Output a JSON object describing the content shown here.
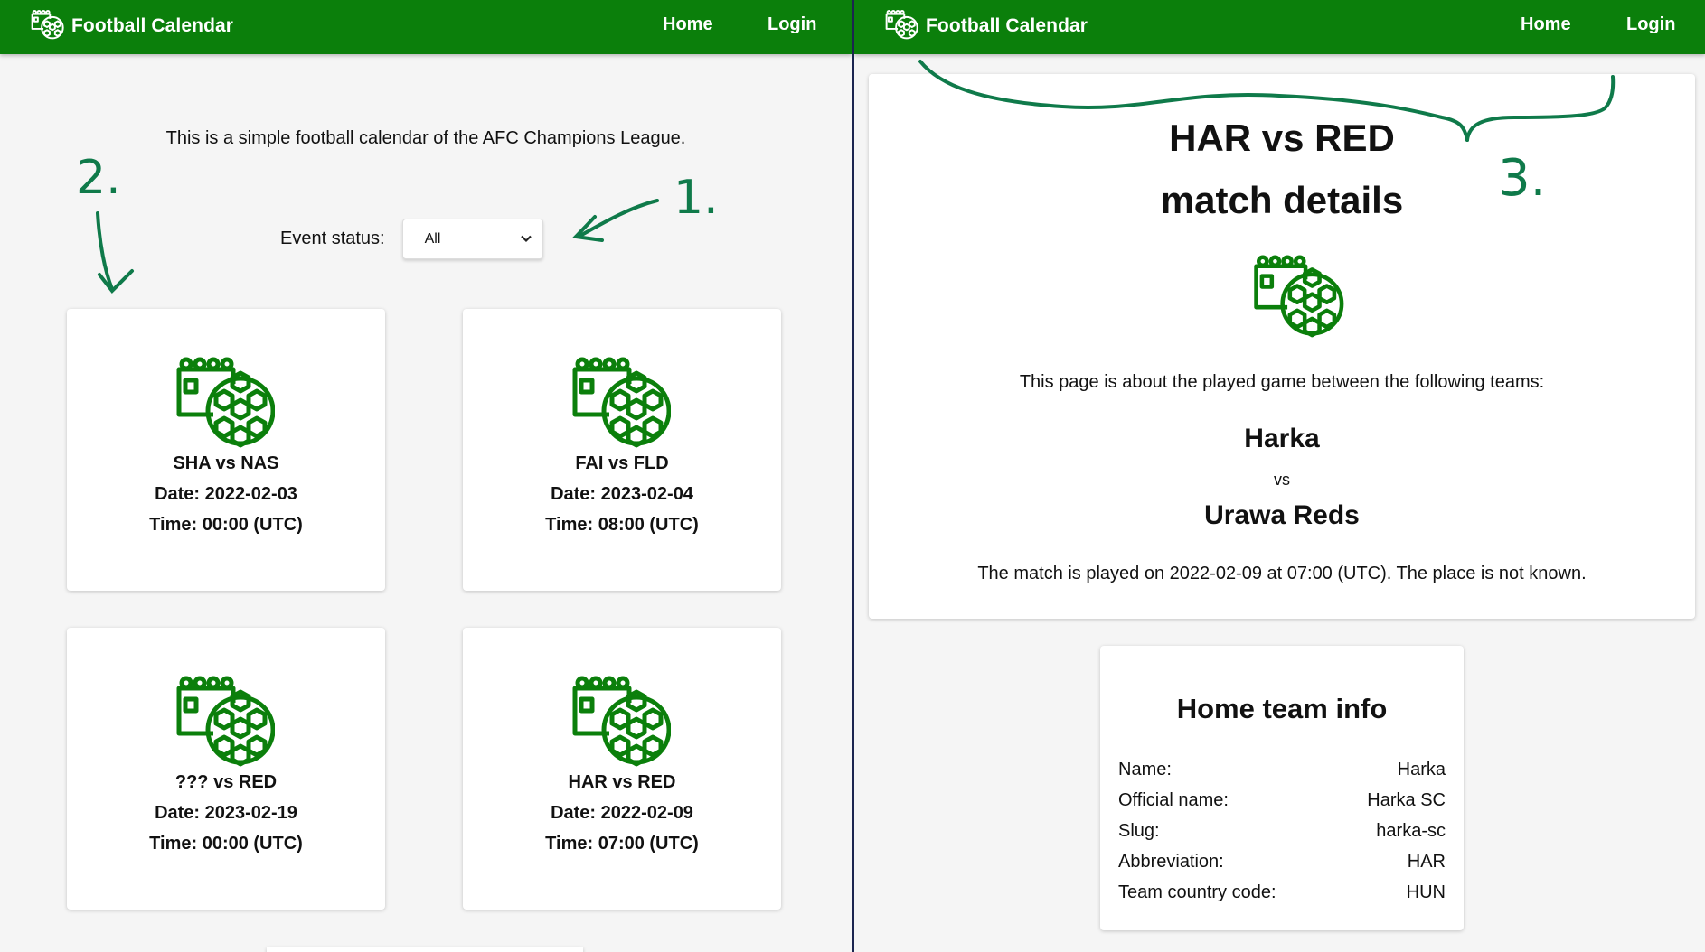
{
  "app": {
    "brand": "Football Calendar",
    "nav": {
      "home": "Home",
      "login": "Login"
    },
    "colors": {
      "accent": "#0b7f0b",
      "annotation": "#0f7a4a",
      "divider": "#1b2550"
    }
  },
  "calendar_page": {
    "intro": "This is a simple football calendar of the AFC Champions League.",
    "filter": {
      "label": "Event status:",
      "selected": "All"
    },
    "events": [
      {
        "title": "SHA vs NAS",
        "date": "Date: 2022-02-03",
        "time": "Time: 00:00 (UTC)",
        "icon": "calendar-ball-icon"
      },
      {
        "title": "FAI vs FLD",
        "date": "Date: 2023-02-04",
        "time": "Time: 08:00 (UTC)",
        "icon": "calendar-ball-icon"
      },
      {
        "title": "??? vs RED",
        "date": "Date: 2023-02-19",
        "time": "Time: 00:00 (UTC)",
        "icon": "calendar-ball-icon"
      },
      {
        "title": "HAR vs RED",
        "date": "Date: 2022-02-09",
        "time": "Time: 07:00 (UTC)",
        "icon": "calendar-ball-icon"
      }
    ]
  },
  "detail_page": {
    "heading1": "HAR vs RED",
    "heading2": "match details",
    "about": "This page is about the played game between the following teams:",
    "home_team": "Harka",
    "vs": "vs",
    "away_team": "Urawa Reds",
    "when": "The match is played on 2022-02-09 at 07:00 (UTC). The place is not known.",
    "home_team_info": {
      "title": "Home team info",
      "rows": [
        {
          "label": "Name:",
          "value": "Harka"
        },
        {
          "label": "Official name:",
          "value": "Harka SC"
        },
        {
          "label": "Slug:",
          "value": "harka-sc"
        },
        {
          "label": "Abbreviation:",
          "value": "HAR"
        },
        {
          "label": "Team country code:",
          "value": "HUN"
        }
      ]
    }
  },
  "annotations": {
    "n1": "1.",
    "n2": "2.",
    "n3": "3."
  }
}
